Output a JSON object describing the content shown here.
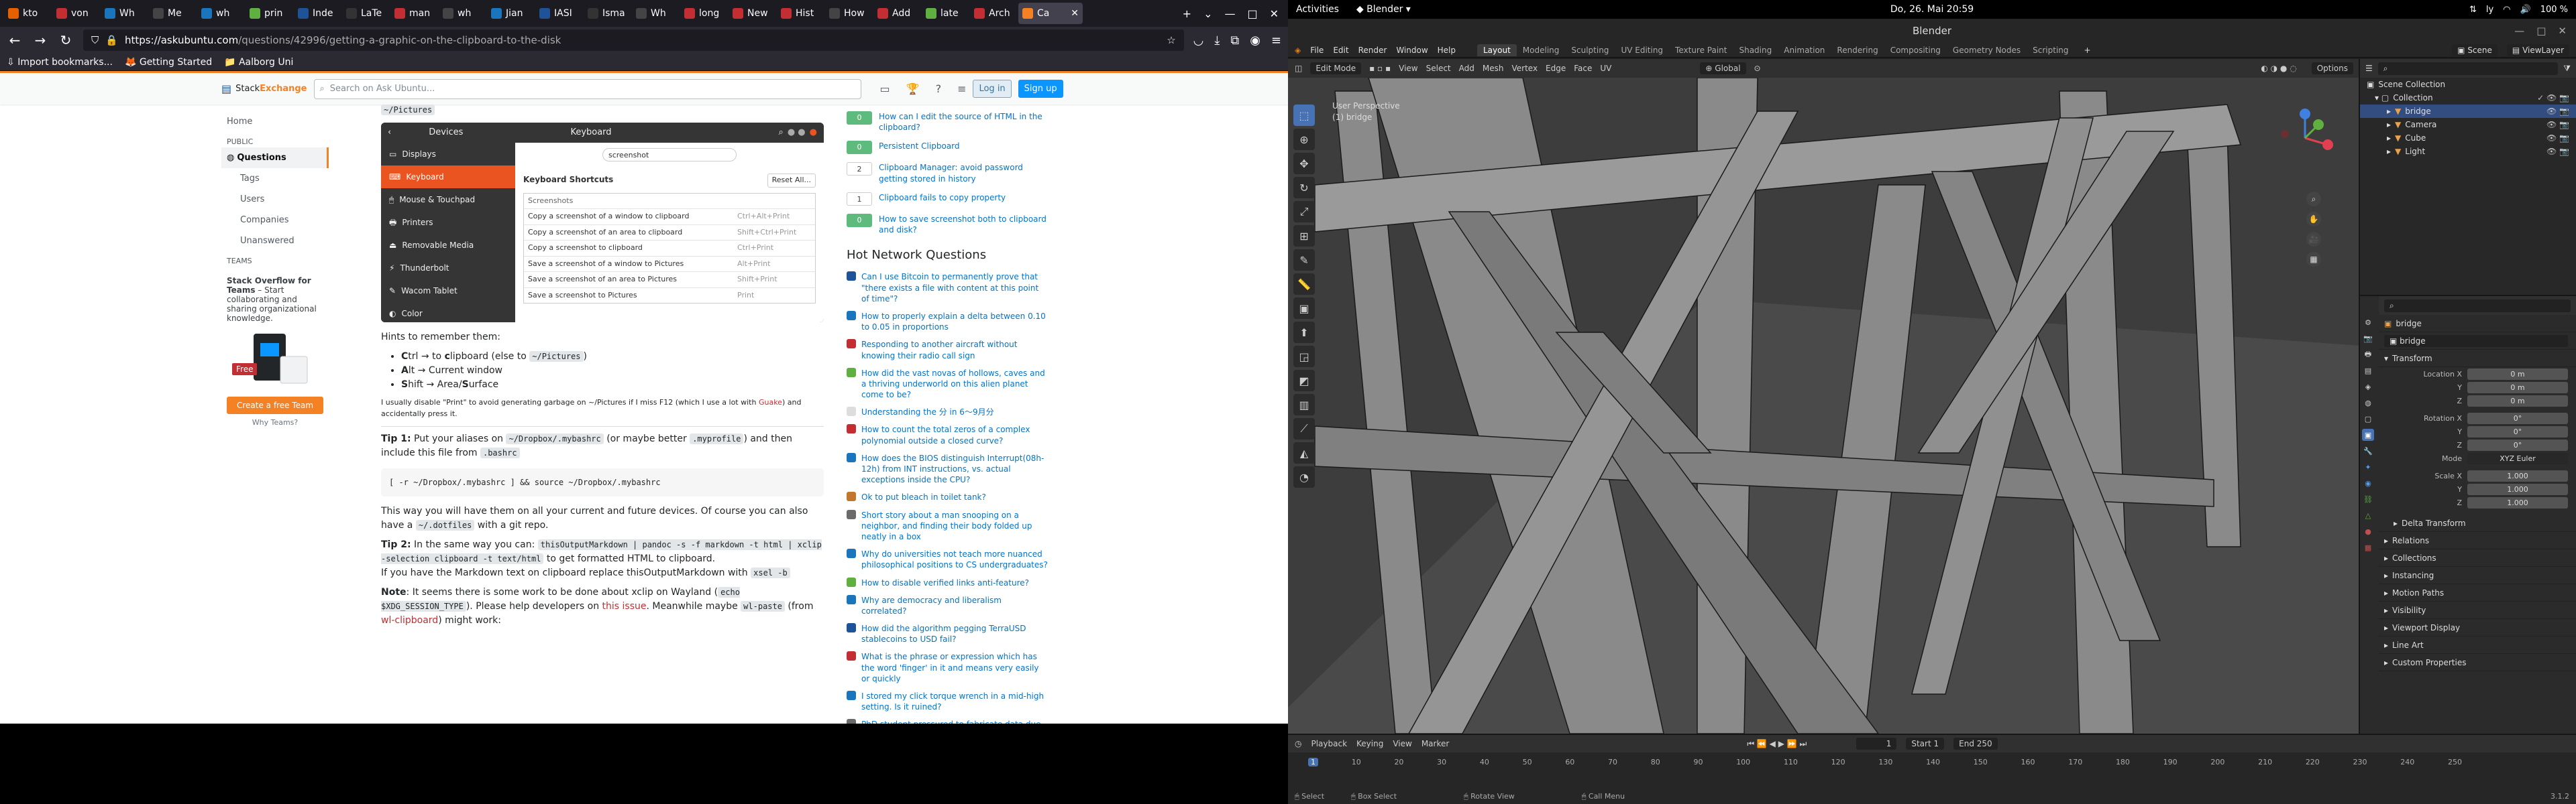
{
  "firefox": {
    "tabs": [
      "kto",
      "von",
      "Wh",
      "Me",
      "wh",
      "prin",
      "Inde",
      "LaTe",
      "man",
      "wh",
      "Jian",
      "IASI",
      "Isma",
      "Wh",
      "long",
      "New",
      "Hist",
      "How",
      "Add",
      "late",
      "Arch",
      "Ca"
    ],
    "url_host": "askubuntu.com",
    "url_path": "/questions/42996/getting-a-graphic-on-the-clipboard-to-the-disk",
    "bookmarks": [
      "Import bookmarks...",
      "Getting Started",
      "Aalborg Uni"
    ]
  },
  "so": {
    "logo_a": "Stack",
    "logo_b": "Exchange",
    "search_placeholder": "Search on Ask Ubuntu...",
    "login": "Log in",
    "signup": "Sign up",
    "nav": {
      "home": "Home",
      "public": "PUBLIC",
      "questions": "Questions",
      "tags": "Tags",
      "users": "Users",
      "companies": "Companies",
      "unanswered": "Unanswered",
      "teams": "TEAMS"
    },
    "teams_title": "Stack Overflow for Teams",
    "teams_text": " – Start collaborating and sharing organizational knowledge.",
    "teams_free": "Free",
    "teams_btn": "Create a free Team",
    "teams_why": "Why Teams?"
  },
  "post": {
    "top_text": "~/Pictures",
    "dialog": {
      "left_title": "Devices",
      "title": "Keyboard",
      "side": [
        "Displays",
        "Keyboard",
        "Mouse & Touchpad",
        "Printers",
        "Removable Media",
        "Thunderbolt",
        "Wacom Tablet",
        "Color"
      ],
      "search": "screenshot",
      "shortcuts_label": "Keyboard Shortcuts",
      "reset": "Reset All...",
      "section": "Screenshots",
      "rows": [
        {
          "name": "Copy a screenshot of a window to clipboard",
          "key": "Ctrl+Alt+Print"
        },
        {
          "name": "Copy a screenshot of an area to clipboard",
          "key": "Shift+Ctrl+Print"
        },
        {
          "name": "Copy a screenshot to clipboard",
          "key": "Ctrl+Print"
        },
        {
          "name": "Save a screenshot of a window to Pictures",
          "key": "Alt+Print"
        },
        {
          "name": "Save a screenshot of an area to Pictures",
          "key": "Shift+Print"
        },
        {
          "name": "Save a screenshot to Pictures",
          "key": "Print"
        }
      ]
    },
    "hints": "Hints to remember them:",
    "bullets": [
      {
        "pre": "C",
        "text": "trl → to ",
        "b": "c",
        "post": "lipboard (else to ",
        "code": "~/Pictures",
        "end": ")"
      },
      {
        "pre": "A",
        "text": "lt → Current window"
      },
      {
        "pre": "S",
        "text": "hift → Area/",
        "b": "S",
        "post": "urface"
      }
    ],
    "print_note_a": "I usually disable \"Print\" to avoid generating garbage on ~/Pictures if I miss F12 (which I use a lot with ",
    "print_note_link": "Guake",
    "print_note_b": ") and accidentally press it.",
    "tip1_label": "Tip 1:",
    "tip1_a": " Put your aliases on ",
    "tip1_code1": "~/Dropbox/.mybashrc",
    "tip1_b": " (or maybe better ",
    "tip1_code2": ".myprofile",
    "tip1_c": ") and then include this file from ",
    "tip1_code3": ".bashrc",
    "pre1": "[ -r ~/Dropbox/.mybashrc ] && source ~/Dropbox/.mybashrc",
    "para_a": "This way you will have them on all your current and future devices. Of course you can also have a ",
    "para_code": "~/.dotfiles",
    "para_b": " with a git repo.",
    "tip2_label": "Tip 2:",
    "tip2_a": " In the same way you can: ",
    "tip2_code": "thisOutputMarkdown | pandoc -s -f markdown -t html | xclip -selection clipboard -t text/html",
    "tip2_b": " to get formatted HTML to clipboard.",
    "tip2_c": "If you have the Markdown text on clipboard replace thisOutputMarkdown with ",
    "tip2_code2": "xsel -b",
    "note_label": "Note",
    "note_a": ": It seems there is some work to be done about xclip on Wayland (",
    "note_code1": "echo $XDG_SESSION_TYPE",
    "note_b": "). Please help developers on ",
    "note_link": "this issue",
    "note_c": ". Meanwhile maybe ",
    "note_code2": "wl-paste",
    "note_d": " (from ",
    "note_link2": "wl-clipboard",
    "note_e": ") might work:"
  },
  "related": [
    {
      "score": "0",
      "title": "How can I edit the source of HTML in the clipboard?",
      "green": true
    },
    {
      "score": "0",
      "title": "Persistent Clipboard",
      "green": true
    },
    {
      "score": "2",
      "title": "Clipboard Manager: avoid password getting stored in history",
      "green": false
    },
    {
      "score": "1",
      "title": "Clipboard fails to copy property",
      "green": false
    },
    {
      "score": "0",
      "title": "How to save screenshot both to clipboard and disk?",
      "green": true
    }
  ],
  "hnq_title": "Hot Network Questions",
  "hnq": [
    {
      "t": "Can I use Bitcoin to permanently prove that \"there exists a file with content at this point of time\"?",
      "c": "#1e5397"
    },
    {
      "t": "How to properly explain a delta between 0.10 to 0.05 in proportions",
      "c": "#1b75bc"
    },
    {
      "t": "Responding to another aircraft without knowing their radio call sign",
      "c": "#c22e32"
    },
    {
      "t": "How did the vast novas of hollows, caves and a thriving underworld on this alien planet come to be?",
      "c": "#5fb040"
    },
    {
      "t": "Understanding the 分 in 6〜9月分",
      "c": "#ddd"
    },
    {
      "t": "How to count the total zeros of a complex polynomial outside a closed curve?",
      "c": "#c22e32"
    },
    {
      "t": "How does the BIOS distinguish Interrupt(08h-12h) from INT instructions, vs. actual exceptions inside the CPU?",
      "c": "#1b75bc"
    },
    {
      "t": "Ok to put bleach in toilet tank?",
      "c": "#c2772e"
    },
    {
      "t": "Short story about a man snooping on a neighbor, and finding their body folded up neatly in a box",
      "c": "#6a6a6a"
    },
    {
      "t": "Why do universities not teach more nuanced philosophical positions to CS undergraduates?",
      "c": "#1b75bc"
    },
    {
      "t": "How to disable verified links anti-feature?",
      "c": "#5fb040"
    },
    {
      "t": "Why are democracy and liberalism correlated?",
      "c": "#1b75bc"
    },
    {
      "t": "How did the algorithm pegging TerraUSD stablecoins to USD fail?",
      "c": "#1e5397"
    },
    {
      "t": "What is the phrase or expression which has the word 'finger' in it and means very easily or quickly",
      "c": "#c22e32"
    },
    {
      "t": "I stored my click torque wrench in a mid-high setting. Is it ruined?",
      "c": "#1b75bc"
    },
    {
      "t": "PhD student pressured to fabricate data due to bad experiment design",
      "c": "#6a6a6a"
    }
  ],
  "gnome": {
    "activities": "Activities",
    "app": "Blender",
    "clock": "Do, 26. Mai  20:59",
    "lang": "ly",
    "battery": "100 %"
  },
  "blender": {
    "title": "Blender",
    "menu": [
      "File",
      "Edit",
      "Render",
      "Window",
      "Help"
    ],
    "workspaces": [
      "Layout",
      "Modeling",
      "Sculpting",
      "UV Editing",
      "Texture Paint",
      "Shading",
      "Animation",
      "Rendering",
      "Compositing",
      "Geometry Nodes",
      "Scripting"
    ],
    "scene": "Scene",
    "viewlayer": "ViewLayer",
    "mode": "Edit Mode",
    "vmenu": [
      "View",
      "Select",
      "Add",
      "Mesh",
      "Vertex",
      "Edge",
      "Face",
      "UV"
    ],
    "orient": "Global",
    "options": "Options",
    "persp1": "User Perspective",
    "persp2": "(1) bridge",
    "outliner": {
      "root": "Scene Collection",
      "coll": "Collection",
      "items": [
        "bridge",
        "Camera",
        "Cube",
        "Light"
      ]
    },
    "props": {
      "obj": "bridge",
      "name": "bridge",
      "transform": "Transform",
      "loc_label": "Location X",
      "loc": [
        "0 m",
        "0 m",
        "0 m"
      ],
      "rot_label": "Rotation X",
      "rot": [
        "0°",
        "0°",
        "0°"
      ],
      "mode_label": "Mode",
      "mode": "XYZ Euler",
      "scale_label": "Scale X",
      "scale": [
        "1.000",
        "1.000",
        "1.000"
      ],
      "y": "Y",
      "z": "Z",
      "sections": [
        "Delta Transform",
        "Relations",
        "Collections",
        "Instancing",
        "Motion Paths",
        "Visibility",
        "Viewport Display",
        "Line Art",
        "Custom Properties"
      ]
    },
    "timeline": {
      "menu": [
        "Playback",
        "Keying",
        "View",
        "Marker"
      ],
      "current": "1",
      "start_label": "Start",
      "start": "1",
      "end_label": "End",
      "end": "250",
      "ticks": [
        "1",
        "10",
        "20",
        "30",
        "40",
        "50",
        "60",
        "70",
        "80",
        "90",
        "100",
        "110",
        "120",
        "130",
        "140",
        "150",
        "160",
        "170",
        "180",
        "190",
        "200",
        "210",
        "220",
        "230",
        "240",
        "250"
      ]
    },
    "status": [
      "Select",
      "Box Select",
      "Rotate View",
      "Call Menu"
    ],
    "version": "3.1.2"
  }
}
